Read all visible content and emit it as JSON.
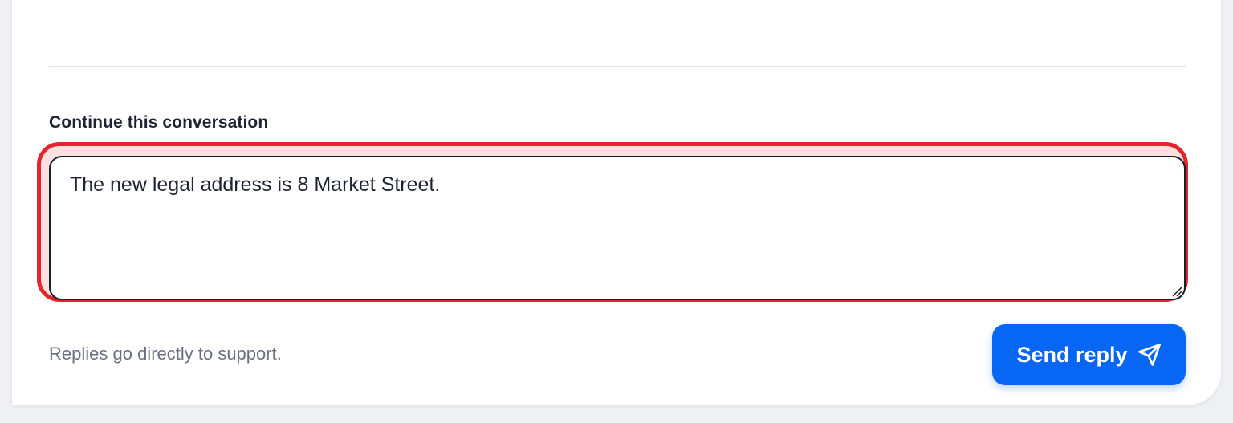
{
  "conversation": {
    "section_label": "Continue this conversation",
    "reply_value": "The new legal address is 8 Market Street.",
    "helper_text": "Replies go directly to support.",
    "send_label": "Send reply",
    "send_icon": "paper-plane-icon"
  },
  "colors": {
    "accent": "#0866f5",
    "highlight": "#e4252e",
    "text": "#1f2433",
    "muted": "#6b7080"
  }
}
